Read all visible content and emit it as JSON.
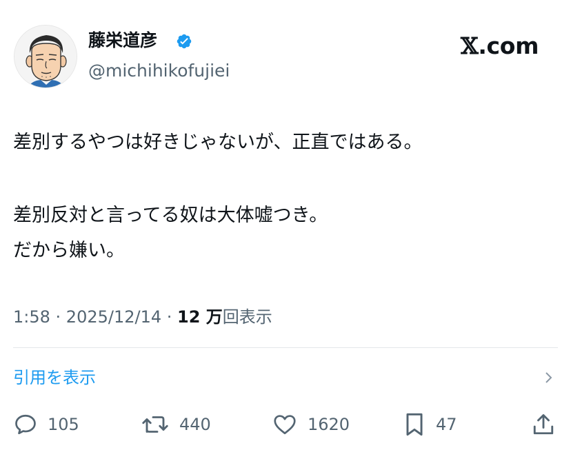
{
  "header": {
    "display_name": "藤栄道彦",
    "handle": "@michihikofujiei",
    "verified_icon": "verified-badge-icon",
    "source_label": ".com",
    "source_x_glyph": "𝕏"
  },
  "tweet": {
    "lines": [
      "差別するやつは好きじゃないが、正直ではある。",
      "差別反対と言ってる奴は大体嘘つき。",
      "だから嫌い。"
    ]
  },
  "meta": {
    "time": "1:58",
    "separator": " · ",
    "date": "2025/12/14",
    "views_count": "12 万",
    "views_label": "回表示"
  },
  "quotes": {
    "label": "引用を表示",
    "chevron_icon": "chevron-right-icon"
  },
  "actions": {
    "reply": {
      "icon": "reply-icon",
      "count": "105"
    },
    "repost": {
      "icon": "repost-icon",
      "count": "440"
    },
    "like": {
      "icon": "heart-icon",
      "count": "1620"
    },
    "bookmark": {
      "icon": "bookmark-icon",
      "count": "47"
    },
    "share": {
      "icon": "share-icon"
    }
  },
  "colors": {
    "text": "#0f1419",
    "secondary": "#536471",
    "link": "#1d9bf0",
    "verified": "#1d9bf0",
    "divider": "#e4e7ea"
  }
}
